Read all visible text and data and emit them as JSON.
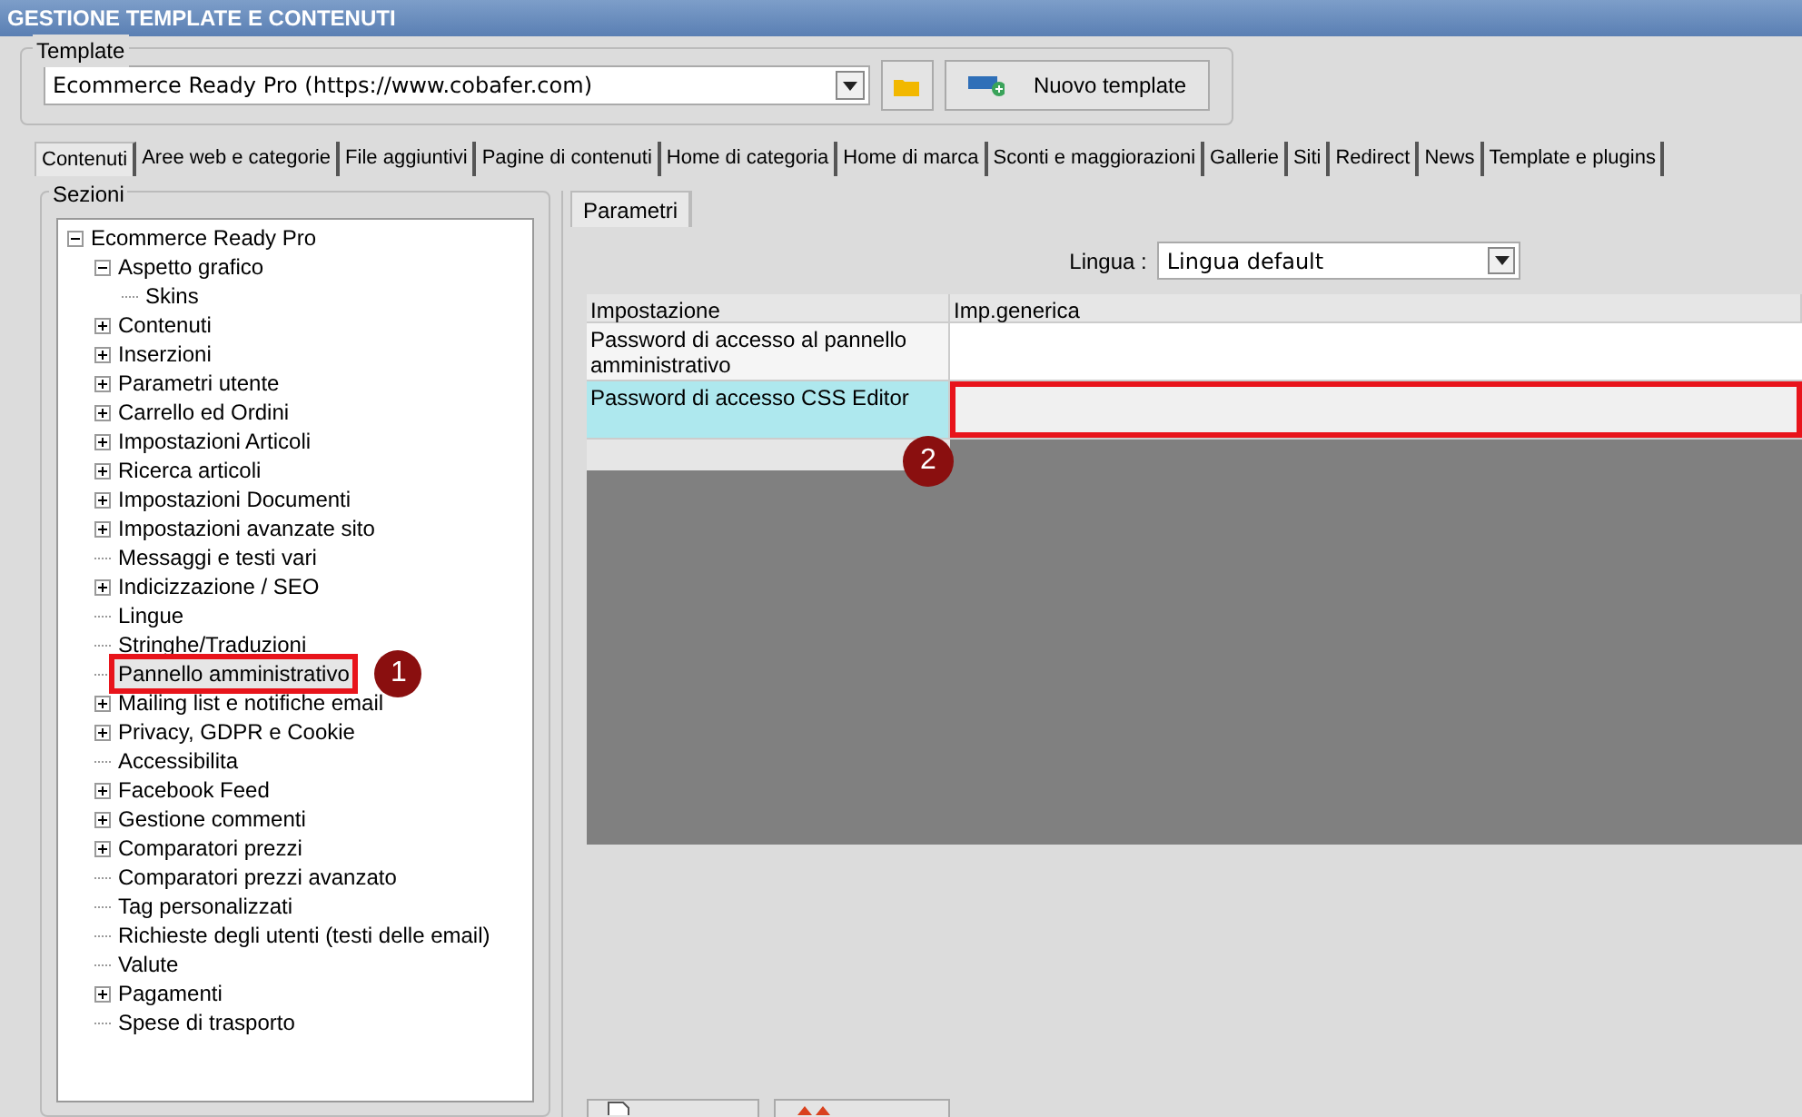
{
  "window": {
    "title": "GESTIONE TEMPLATE E CONTENUTI"
  },
  "template": {
    "label": "Template",
    "value": "Ecommerce Ready Pro (https://www.cobafer.com)",
    "new_button": "Nuovo template"
  },
  "tabs": [
    {
      "label": "Contenuti",
      "selected": true
    },
    {
      "label": "Aree web e categorie",
      "selected": false
    },
    {
      "label": "File aggiuntivi",
      "selected": false
    },
    {
      "label": "Pagine di contenuti",
      "selected": false
    },
    {
      "label": "Home di categoria",
      "selected": false
    },
    {
      "label": "Home di marca",
      "selected": false
    },
    {
      "label": "Sconti e maggiorazioni",
      "selected": false
    },
    {
      "label": "Gallerie",
      "selected": false
    },
    {
      "label": "Siti",
      "selected": false
    },
    {
      "label": "Redirect",
      "selected": false
    },
    {
      "label": "News",
      "selected": false
    },
    {
      "label": "Template e plugins",
      "selected": false
    }
  ],
  "sections": {
    "label": "Sezioni",
    "tree": [
      {
        "label": "Ecommerce Ready Pro",
        "selected": false,
        "expanded": true,
        "children": [
          {
            "label": "Aspetto grafico",
            "selected": false,
            "expanded": true,
            "children": [
              {
                "label": "Skins",
                "selected": false
              }
            ]
          },
          {
            "label": "Contenuti",
            "selected": false,
            "expanded": false
          },
          {
            "label": "Inserzioni",
            "selected": false,
            "expanded": false
          },
          {
            "label": "Parametri utente",
            "selected": false,
            "expanded": false
          },
          {
            "label": "Carrello ed Ordini",
            "selected": false,
            "expanded": false
          },
          {
            "label": "Impostazioni Articoli",
            "selected": false,
            "expanded": false
          },
          {
            "label": "Ricerca articoli",
            "selected": false,
            "expanded": false
          },
          {
            "label": "Impostazioni Documenti",
            "selected": false,
            "expanded": false
          },
          {
            "label": "Impostazioni avanzate sito",
            "selected": false,
            "expanded": false
          },
          {
            "label": "Messaggi e testi vari",
            "selected": false
          },
          {
            "label": "Indicizzazione / SEO",
            "selected": false,
            "expanded": false
          },
          {
            "label": "Lingue",
            "selected": false
          },
          {
            "label": "Stringhe/Traduzioni",
            "selected": false
          },
          {
            "label": "Pannello amministrativo",
            "selected": true,
            "callout": "1"
          },
          {
            "label": "Mailing list e notifiche email",
            "selected": false,
            "expanded": false
          },
          {
            "label": "Privacy, GDPR e Cookie",
            "selected": false,
            "expanded": false
          },
          {
            "label": "Accessibilita",
            "selected": false
          },
          {
            "label": "Facebook Feed",
            "selected": false,
            "expanded": false
          },
          {
            "label": "Gestione commenti",
            "selected": false,
            "expanded": false
          },
          {
            "label": "Comparatori prezzi",
            "selected": false,
            "expanded": false
          },
          {
            "label": "Comparatori prezzi avanzato",
            "selected": false
          },
          {
            "label": "Tag personalizzati",
            "selected": false
          },
          {
            "label": "Richieste degli utenti (testi delle email)",
            "selected": false
          },
          {
            "label": "Valute",
            "selected": false
          },
          {
            "label": "Pagamenti",
            "selected": false,
            "expanded": false
          },
          {
            "label": "Spese di trasporto",
            "selected": false
          }
        ]
      }
    ]
  },
  "panel_tabs": [
    {
      "label": "Parametri",
      "selected": true
    }
  ],
  "language": {
    "label": "Lingua :",
    "value": "Lingua default"
  },
  "table": {
    "columns": [
      "Impostazione",
      "Imp.generica"
    ],
    "rows": [
      {
        "setting": "Password di accesso al pannello amministrativo",
        "selected": false
      },
      {
        "setting": "Password di accesso CSS Editor",
        "selected": true,
        "callout": "2"
      }
    ]
  }
}
